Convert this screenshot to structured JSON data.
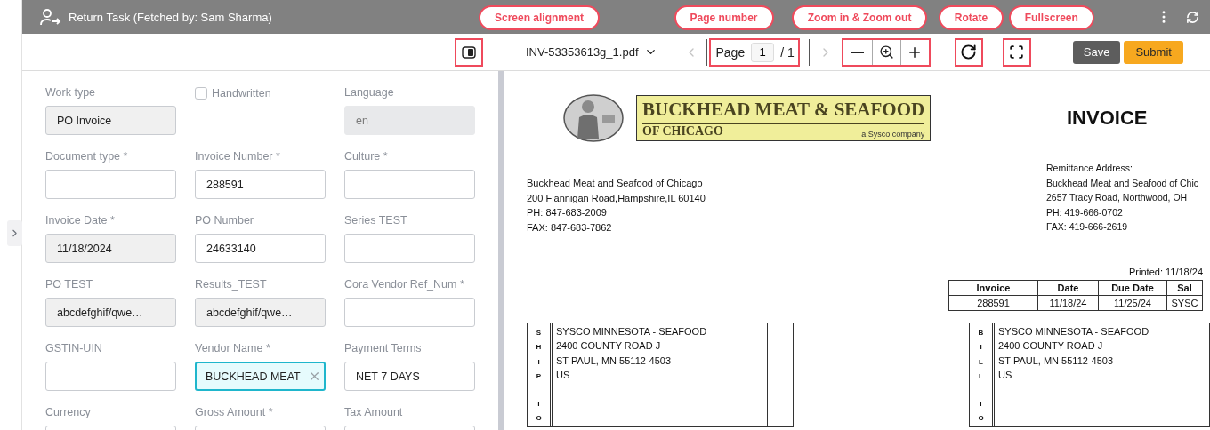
{
  "top_bar": {
    "title": "Return Task (Fetched by: Sam Sharma)"
  },
  "toolbar": {
    "layout_toggle": {
      "callout": "Screen alignment"
    },
    "file_name": "INV-53353613g_1.pdf",
    "prev": {
      "disabled": true
    },
    "page": {
      "label": "Page",
      "value": "1",
      "total": "/ 1",
      "callout": "Page number"
    },
    "next": {
      "disabled": true
    },
    "zoom": {
      "callout": "Zoom in & Zoom out"
    },
    "rotate": {
      "callout": "Rotate"
    },
    "fullscreen": {
      "callout": "Fullscreen"
    },
    "save": "Save",
    "submit": "Submit"
  },
  "form": {
    "fields": [
      {
        "kind": "input",
        "label": "Work type",
        "value": "PO Invoice",
        "read_only": true,
        "disabled": false,
        "focused": false
      },
      {
        "kind": "checkbox",
        "label": "Handwritten",
        "checked": false
      },
      {
        "kind": "input",
        "label": "Language",
        "value": "en",
        "read_only": true,
        "disabled": true,
        "focused": false
      },
      {
        "kind": "input",
        "label": "Document type *",
        "read_only": false,
        "disabled": false,
        "focused": false
      },
      {
        "kind": "input",
        "label": "Invoice Number *",
        "value": "288591",
        "read_only": false,
        "disabled": false,
        "focused": false
      },
      {
        "kind": "input",
        "label": "Culture *",
        "read_only": false,
        "disabled": false,
        "focused": false
      },
      {
        "kind": "input",
        "label": "Invoice Date *",
        "value": "11/18/2024",
        "read_only": true,
        "disabled": false,
        "focused": false
      },
      {
        "kind": "input",
        "label": "PO Number",
        "value": "24633140",
        "read_only": false,
        "disabled": false,
        "focused": false
      },
      {
        "kind": "input",
        "label": "Series TEST",
        "read_only": false,
        "disabled": false,
        "focused": false
      },
      {
        "kind": "input",
        "label": "PO TEST",
        "value": "abcdefghif/qwe…",
        "read_only": true,
        "disabled": false,
        "focused": false
      },
      {
        "kind": "input",
        "label": "Results_TEST",
        "value": "abcdefghif/qwe…",
        "read_only": true,
        "disabled": false,
        "focused": false
      },
      {
        "kind": "input",
        "label": "Cora Vendor Ref_Num *",
        "read_only": false,
        "disabled": false,
        "focused": false
      },
      {
        "kind": "input",
        "label": "GSTIN-UIN",
        "read_only": false,
        "disabled": false,
        "focused": false
      },
      {
        "kind": "input",
        "label": "Vendor Name *",
        "value": "BUCKHEAD MEAT",
        "read_only": false,
        "disabled": false,
        "focused": true
      },
      {
        "kind": "input",
        "label": "Payment Terms",
        "value": "NET 7 DAYS",
        "read_only": false,
        "disabled": false,
        "focused": false
      },
      {
        "kind": "input",
        "label": "Currency"
      },
      {
        "kind": "input",
        "label": "Gross Amount *"
      },
      {
        "kind": "input",
        "label": "Tax Amount"
      }
    ]
  },
  "document": {
    "logo": {
      "name": "BUCKHEAD MEAT & SEAFOOD",
      "sub": "OF CHICAGO",
      "tagline": "a Sysco company"
    },
    "title": "INVOICE",
    "sender_lines": [
      "Buckhead Meat and Seafood of Chicago",
      "200 Flannigan Road,Hampshire,IL 60140",
      "PH: 847-683-2009",
      "FAX: 847-683-7862"
    ],
    "remittance_lines": [
      "Remittance Address:",
      "Buckhead Meat and Seafood of Chic",
      "2657 Tracy Road, Northwood, OH",
      "PH: 419-666-0702",
      "FAX: 419-666-2619"
    ],
    "printed": "Printed:  11/18/24",
    "table": {
      "columns": [
        "Invoice",
        "Date",
        "Due Date",
        "Sal"
      ],
      "rows": [
        [
          "288591",
          "11/18/24",
          "11/25/24",
          "SYSC"
        ]
      ]
    },
    "ship_to": {
      "side_letters": [
        [
          "S",
          "H",
          "I",
          "P"
        ],
        [
          "T",
          "O"
        ]
      ],
      "lines": [
        "SYSCO MINNESOTA - SEAFOOD",
        "2400 COUNTY ROAD J",
        "ST PAUL, MN  55112-4503",
        "US"
      ]
    },
    "bill_to": {
      "side_letters": [
        [
          "B",
          "I",
          "L",
          "L"
        ],
        [
          "T",
          "O"
        ]
      ],
      "lines": [
        "SYSCO MINNESOTA - SEAFOOD",
        "2400 COUNTY ROAD J",
        "ST PAUL, MN  55112-4503",
        "US"
      ]
    }
  }
}
